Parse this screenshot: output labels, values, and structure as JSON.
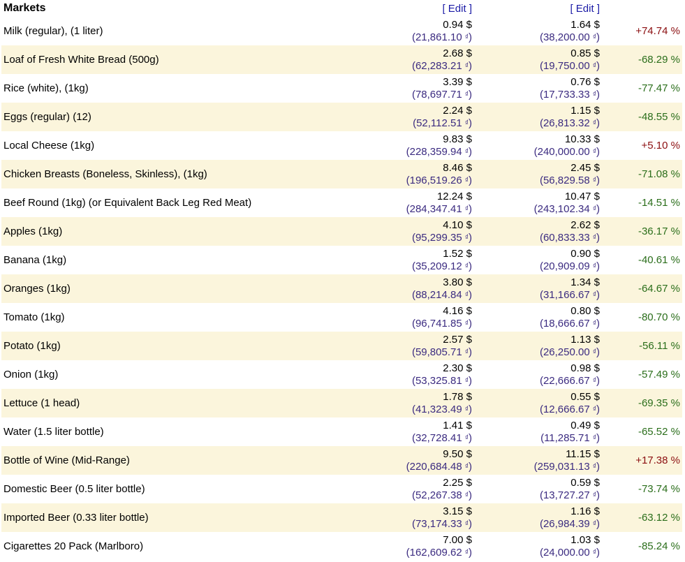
{
  "header": {
    "title": "Markets",
    "edit_label_1": "[ Edit ]",
    "edit_label_2": "[ Edit ]"
  },
  "colors": {
    "alt_row_bg": "#fbf5dc",
    "increase": "#8b0e10",
    "decrease": "#2b6e1b",
    "local_currency": "#3b2b80",
    "link": "#1a1aa6"
  },
  "currency_symbol": "₫",
  "rows": [
    {
      "name": "Milk (regular), (1 liter)",
      "usd1": "0.94 $",
      "loc1": "(21,861.10 ",
      "usd2": "1.64 $",
      "loc2": "(38,200.00 ",
      "diff": "+74.74 %",
      "dir": "up"
    },
    {
      "name": "Loaf of Fresh White Bread (500g)",
      "usd1": "2.68 $",
      "loc1": "(62,283.21 ",
      "usd2": "0.85 $",
      "loc2": "(19,750.00 ",
      "diff": "-68.29 %",
      "dir": "down"
    },
    {
      "name": "Rice (white), (1kg)",
      "usd1": "3.39 $",
      "loc1": "(78,697.71 ",
      "usd2": "0.76 $",
      "loc2": "(17,733.33 ",
      "diff": "-77.47 %",
      "dir": "down"
    },
    {
      "name": "Eggs (regular) (12)",
      "usd1": "2.24 $",
      "loc1": "(52,112.51 ",
      "usd2": "1.15 $",
      "loc2": "(26,813.32 ",
      "diff": "-48.55 %",
      "dir": "down"
    },
    {
      "name": "Local Cheese (1kg)",
      "usd1": "9.83 $",
      "loc1": "(228,359.94 ",
      "usd2": "10.33 $",
      "loc2": "(240,000.00 ",
      "diff": "+5.10 %",
      "dir": "up"
    },
    {
      "name": "Chicken Breasts (Boneless, Skinless), (1kg)",
      "usd1": "8.46 $",
      "loc1": "(196,519.26 ",
      "usd2": "2.45 $",
      "loc2": "(56,829.58 ",
      "diff": "-71.08 %",
      "dir": "down"
    },
    {
      "name": "Beef Round (1kg) (or Equivalent Back Leg Red Meat)",
      "usd1": "12.24 $",
      "loc1": "(284,347.41 ",
      "usd2": "10.47 $",
      "loc2": "(243,102.34 ",
      "diff": "-14.51 %",
      "dir": "down"
    },
    {
      "name": "Apples (1kg)",
      "usd1": "4.10 $",
      "loc1": "(95,299.35 ",
      "usd2": "2.62 $",
      "loc2": "(60,833.33 ",
      "diff": "-36.17 %",
      "dir": "down"
    },
    {
      "name": "Banana (1kg)",
      "usd1": "1.52 $",
      "loc1": "(35,209.12 ",
      "usd2": "0.90 $",
      "loc2": "(20,909.09 ",
      "diff": "-40.61 %",
      "dir": "down"
    },
    {
      "name": "Oranges (1kg)",
      "usd1": "3.80 $",
      "loc1": "(88,214.84 ",
      "usd2": "1.34 $",
      "loc2": "(31,166.67 ",
      "diff": "-64.67 %",
      "dir": "down"
    },
    {
      "name": "Tomato (1kg)",
      "usd1": "4.16 $",
      "loc1": "(96,741.85 ",
      "usd2": "0.80 $",
      "loc2": "(18,666.67 ",
      "diff": "-80.70 %",
      "dir": "down"
    },
    {
      "name": "Potato (1kg)",
      "usd1": "2.57 $",
      "loc1": "(59,805.71 ",
      "usd2": "1.13 $",
      "loc2": "(26,250.00 ",
      "diff": "-56.11 %",
      "dir": "down"
    },
    {
      "name": "Onion (1kg)",
      "usd1": "2.30 $",
      "loc1": "(53,325.81 ",
      "usd2": "0.98 $",
      "loc2": "(22,666.67 ",
      "diff": "-57.49 %",
      "dir": "down"
    },
    {
      "name": "Lettuce (1 head)",
      "usd1": "1.78 $",
      "loc1": "(41,323.49 ",
      "usd2": "0.55 $",
      "loc2": "(12,666.67 ",
      "diff": "-69.35 %",
      "dir": "down"
    },
    {
      "name": "Water (1.5 liter bottle)",
      "usd1": "1.41 $",
      "loc1": "(32,728.41 ",
      "usd2": "0.49 $",
      "loc2": "(11,285.71 ",
      "diff": "-65.52 %",
      "dir": "down"
    },
    {
      "name": "Bottle of Wine (Mid-Range)",
      "usd1": "9.50 $",
      "loc1": "(220,684.48 ",
      "usd2": "11.15 $",
      "loc2": "(259,031.13 ",
      "diff": "+17.38 %",
      "dir": "up"
    },
    {
      "name": "Domestic Beer (0.5 liter bottle)",
      "usd1": "2.25 $",
      "loc1": "(52,267.38 ",
      "usd2": "0.59 $",
      "loc2": "(13,727.27 ",
      "diff": "-73.74 %",
      "dir": "down"
    },
    {
      "name": "Imported Beer (0.33 liter bottle)",
      "usd1": "3.15 $",
      "loc1": "(73,174.33 ",
      "usd2": "1.16 $",
      "loc2": "(26,984.39 ",
      "diff": "-63.12 %",
      "dir": "down"
    },
    {
      "name": "Cigarettes 20 Pack (Marlboro)",
      "usd1": "7.00 $",
      "loc1": "(162,609.62 ",
      "usd2": "1.03 $",
      "loc2": "(24,000.00 ",
      "diff": "-85.24 %",
      "dir": "down"
    }
  ]
}
